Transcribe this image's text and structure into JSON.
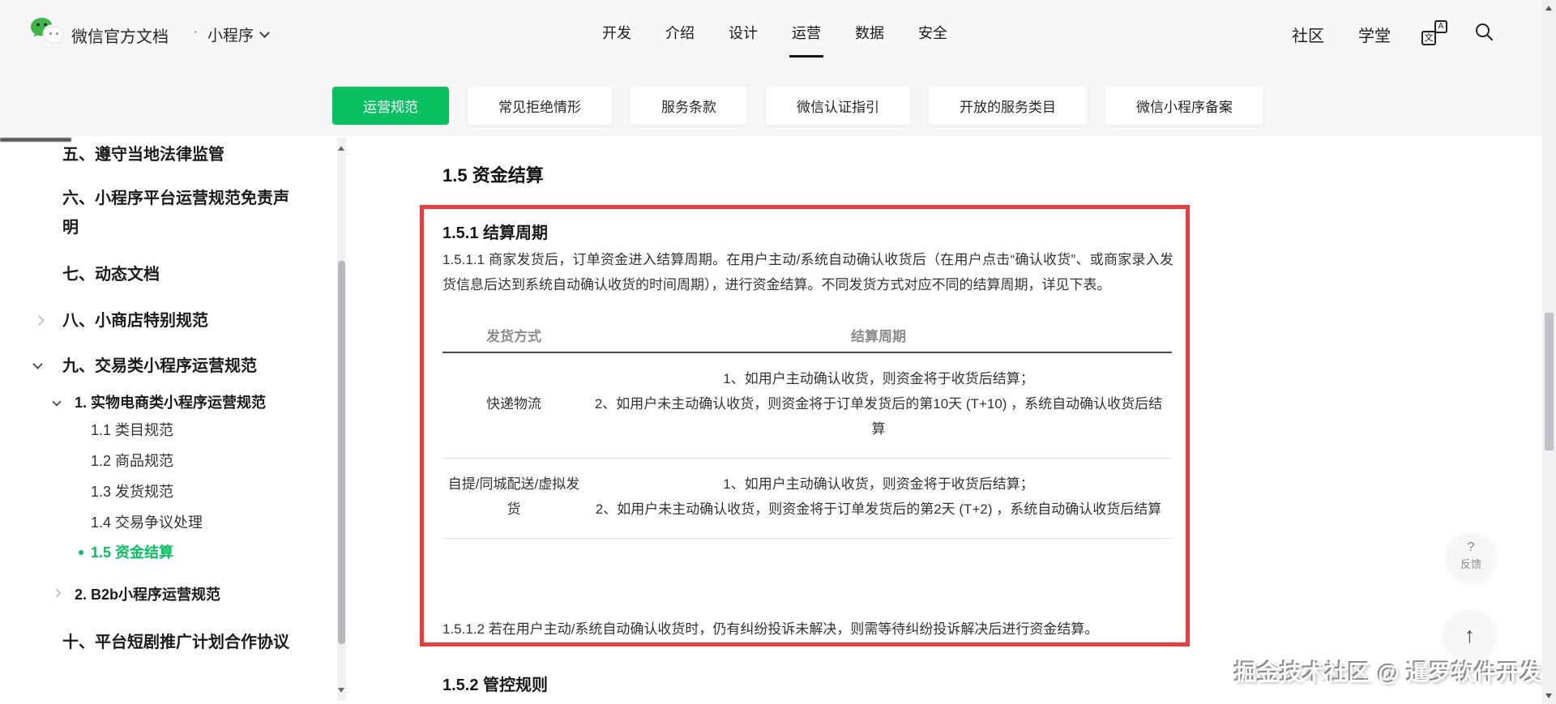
{
  "header": {
    "title": "微信官方文档",
    "separator": "·",
    "product": "小程序",
    "nav": [
      {
        "label": "开发"
      },
      {
        "label": "介绍"
      },
      {
        "label": "设计"
      },
      {
        "label": "运营",
        "active": true
      },
      {
        "label": "数据"
      },
      {
        "label": "安全"
      }
    ],
    "links": [
      {
        "label": "社区"
      },
      {
        "label": "学堂"
      }
    ],
    "icons": {
      "translate_front": "文",
      "translate_back": "A",
      "search": "magnifier"
    }
  },
  "tabs": [
    {
      "label": "运营规范",
      "active": true
    },
    {
      "label": "常见拒绝情形"
    },
    {
      "label": "服务条款"
    },
    {
      "label": "微信认证指引"
    },
    {
      "label": "开放的服务类目"
    },
    {
      "label": "微信小程序备案"
    }
  ],
  "sidebar": {
    "items": [
      {
        "label": "五、遵守当地法律监管",
        "level": 1
      },
      {
        "label": "六、小程序平台运营规范免责声明",
        "level": 1
      },
      {
        "label": "七、动态文档",
        "level": 1
      },
      {
        "label": "八、小商店特别规范",
        "level": 1,
        "chevron": "right"
      },
      {
        "label": "九、交易类小程序运营规范",
        "level": 1,
        "chevron": "down"
      },
      {
        "label": "1. 实物电商类小程序运营规范",
        "level": 2,
        "chevron": "down"
      },
      {
        "label": "1.1 类目规范",
        "level": 3
      },
      {
        "label": "1.2 商品规范",
        "level": 3
      },
      {
        "label": "1.3 发货规范",
        "level": 3
      },
      {
        "label": "1.4 交易争议处理",
        "level": 3
      },
      {
        "label": "1.5 资金结算",
        "level": 3,
        "active": true
      },
      {
        "label": "2. B2b小程序运营规范",
        "level": 2,
        "chevron": "right"
      },
      {
        "label": "十、平台短剧推广计划合作协议",
        "level": 1
      }
    ]
  },
  "content": {
    "section_title": "1.5 资金结算",
    "highlight": {
      "sub_title": "1.5.1 结算周期",
      "para1": "1.5.1.1 商家发货后，订单资金进入结算周期。在用户主动/系统自动确认收货后（在用户点击“确认收货”、或商家录入发货信息后达到系统自动确认收货的时间周期），进行资金结算。不同发货方式对应不同的结算周期，详见下表。",
      "table": {
        "headers": [
          "发货方式",
          "结算周期"
        ],
        "rows": [
          {
            "method": "快递物流",
            "period_lines": [
              "1、如用户主动确认收货，则资金将于收货后结算；",
              "2、如用户未主动确认收货，则资金将于订单发货后的第10天 (T+10) ，系统自动确认收货后结算"
            ]
          },
          {
            "method": "自提/同城配送/虚拟发货",
            "period_lines": [
              "1、如用户主动确认收货，则资金将于收货后结算；",
              "2、如用户未主动确认收货，则资金将于订单发货后的第2天 (T+2) ，系统自动确认收货后结算"
            ]
          }
        ]
      },
      "para2": "1.5.1.2 若在用户主动/系统自动确认收货时，仍有纠纷投诉未解决，则需等待纠纷投诉解决后进行资金结算。"
    },
    "next_section_title": "1.5.2 管控规则"
  },
  "floating": {
    "feedback_question": "?",
    "feedback_label": "反馈",
    "back_top_arrow": "↑"
  },
  "watermark": "掘金技术社区 @ 暹罗软件开发",
  "colors": {
    "brand_green": "#07c160",
    "highlight_red": "#ee3c3c"
  }
}
